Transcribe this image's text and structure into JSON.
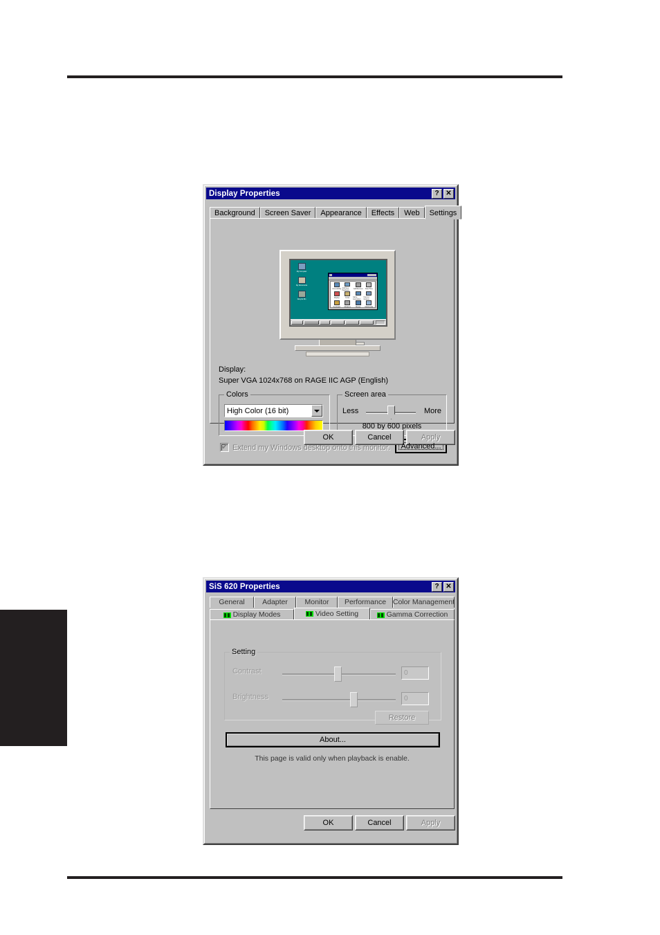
{
  "page": {
    "background": "#ffffff",
    "rule_color": "#231f20",
    "tab_color": "#231f20"
  },
  "display_properties": {
    "title": "Display Properties",
    "titlebar_color": "#0a0a8c",
    "help_button": "?",
    "close_button": "✕",
    "tabs": [
      {
        "label": "Background",
        "selected": false
      },
      {
        "label": "Screen Saver",
        "selected": false
      },
      {
        "label": "Appearance",
        "selected": false
      },
      {
        "label": "Effects",
        "selected": false
      },
      {
        "label": "Web",
        "selected": false
      },
      {
        "label": "Settings",
        "selected": true
      }
    ],
    "preview": {
      "desktop_color": "#008080",
      "desktop_icons": [
        {
          "label": "My Computer"
        },
        {
          "label": "My Documents"
        },
        {
          "label": "Recycle Bin"
        }
      ],
      "inner_window": {
        "icon_count": 12,
        "icon_labels": [
          "Accessibility",
          "Add New Hardware",
          "Add/Remove",
          "Date/Time",
          "Display",
          "Fonts",
          "Game Controllers",
          "Internet Options",
          "Keyboard",
          "Modems",
          "Mouse",
          "Multimedia"
        ]
      },
      "taskbar": {
        "start_label": "Start",
        "task_count": 4
      }
    },
    "display_label": "Display:",
    "display_value": "Super VGA 1024x768 on RAGE IIC AGP (English)",
    "colors_group": {
      "title": "Colors",
      "selected_value": "High Color (16 bit)",
      "dropdown_icon": "chevron-down-icon"
    },
    "screen_area_group": {
      "title": "Screen area",
      "less_label": "Less",
      "more_label": "More",
      "value_label": "800 by 600 pixels",
      "slider_percent": 50
    },
    "extend_checkbox": {
      "label": "Extend my Windows desktop onto this monitor.",
      "checked": true,
      "enabled": false
    },
    "advanced_button": "Advanced...",
    "buttons": {
      "ok": "OK",
      "cancel": "Cancel",
      "apply": "Apply",
      "apply_enabled": false
    }
  },
  "sis_properties": {
    "title": "SiS 620 Properties",
    "titlebar_color": "#0a0a8c",
    "help_button": "?",
    "close_button": "✕",
    "tabs_row1": [
      {
        "label": "General",
        "selected": false
      },
      {
        "label": "Adapter",
        "selected": false
      },
      {
        "label": "Monitor",
        "selected": false
      },
      {
        "label": "Performance",
        "selected": false
      },
      {
        "label": "Color Management",
        "selected": false
      }
    ],
    "tabs_row2": [
      {
        "label": "Display Modes",
        "selected": false,
        "icon": "sis-logo-icon"
      },
      {
        "label": "Video Setting",
        "selected": true,
        "icon": "sis-logo-icon"
      },
      {
        "label": "Gamma Correction",
        "selected": false,
        "icon": "sis-logo-icon"
      }
    ],
    "setting_group": {
      "title": "Setting",
      "enabled": false,
      "sliders": [
        {
          "label": "Contrast",
          "percent": 46,
          "value": "0"
        },
        {
          "label": "Brightness",
          "percent": 58,
          "value": "0"
        }
      ],
      "restore_button": "Restore"
    },
    "about_button": "About...",
    "note": "This page is valid only when playback is enable.",
    "buttons": {
      "ok": "OK",
      "cancel": "Cancel",
      "apply": "Apply",
      "apply_enabled": false
    }
  }
}
